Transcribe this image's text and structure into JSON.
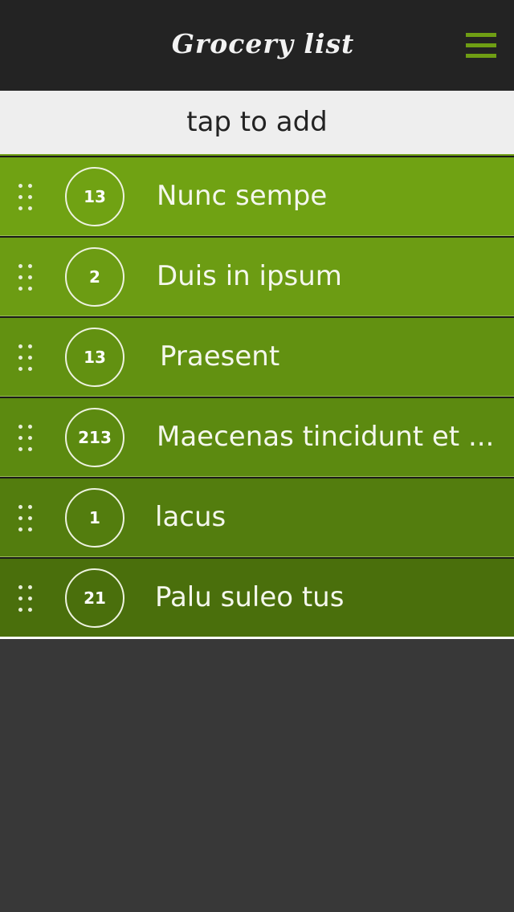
{
  "header": {
    "title": "Grocery list",
    "menu_icon": "hamburger-menu-icon",
    "accent_color": "#6f9e14",
    "background_color": "#232323"
  },
  "add_bar": {
    "placeholder": "tap to add"
  },
  "items": [
    {
      "quantity": "13",
      "name": "Nunc sempe",
      "color": "#70a213"
    },
    {
      "quantity": "2",
      "name": "Duis in ipsum",
      "color": "#6c9c13"
    },
    {
      "quantity": "13",
      "name": "Praesent",
      "color": "#629111"
    },
    {
      "quantity": "213",
      "name": "Maecenas tincidunt et ...",
      "color": "#5c8a10"
    },
    {
      "quantity": "1",
      "name": "lacus",
      "color": "#537d0e"
    },
    {
      "quantity": "21",
      "name": "Palu suleo tus",
      "color": "#4a6f0c"
    }
  ],
  "drag_icon": "drag-handle-icon"
}
